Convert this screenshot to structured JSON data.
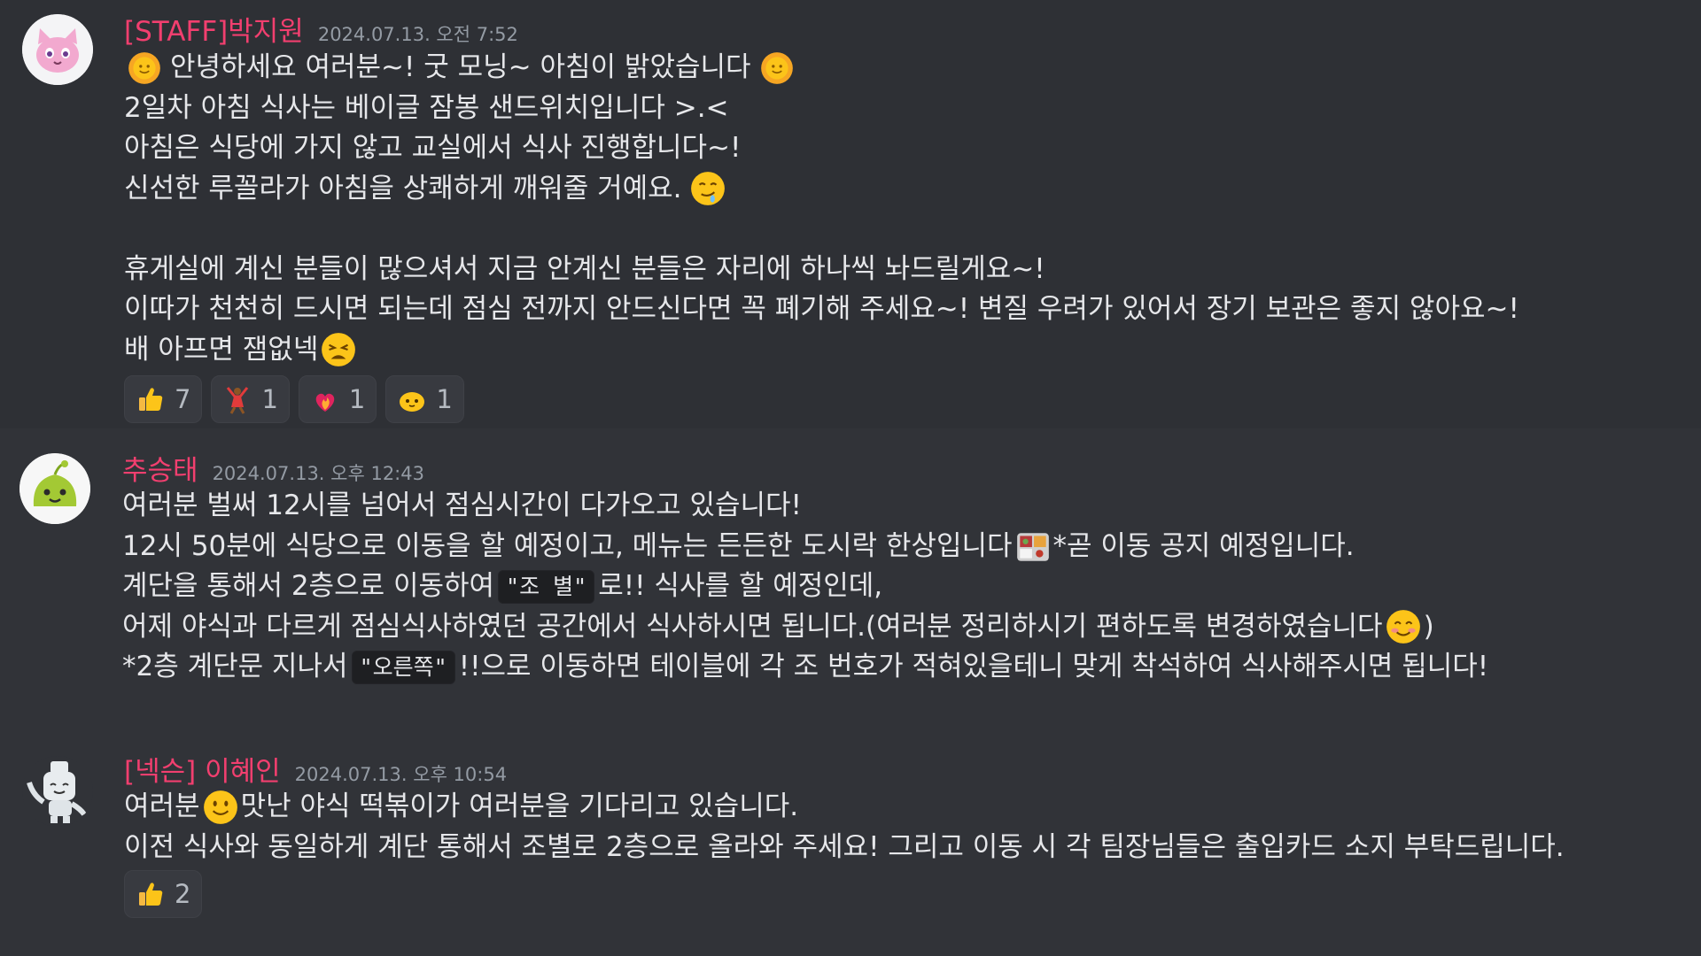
{
  "messages": [
    {
      "author": "[STAFF]박지원",
      "timestamp": "2024.07.13. 오전 7:52",
      "avatar": "pink-cat-avatar",
      "lines": [
        {
          "text": "안녕하세요 여러분~! 굿 모닝~ 아침이 밝았습니다"
        },
        {
          "text": "2일차 아침 식사는 베이글 잠봉 샌드위치입니다 >.<"
        },
        {
          "text": "아침은 식당에 가지 않고 교실에서 식사 진행합니다~!"
        },
        {
          "text": "신선한 루꼴라가 아침을 상쾌하게 깨워줄 거예요."
        },
        {
          "text": ""
        },
        {
          "text": "휴게실에 계신 분들이 많으셔서 지금 안계신 분들은 자리에 하나씩 놔드릴게요~!"
        },
        {
          "text": "이따가 천천히 드시면 되는데 점심 전까지 안드신다면 꼭 폐기해 주세요~! 변질 우려가 있어서 장기 보관은 좋지 않아요~!"
        },
        {
          "text": "배 아프면 잼없넥"
        }
      ],
      "reactions": [
        {
          "icon": "thumbs-up",
          "count": "7"
        },
        {
          "icon": "dancer",
          "count": "1"
        },
        {
          "icon": "fire",
          "count": "1"
        },
        {
          "icon": "blob",
          "count": "1"
        }
      ]
    },
    {
      "author": "추승태",
      "timestamp": "2024.07.13. 오후 12:43",
      "avatar": "green-slime-avatar",
      "lines": [
        {
          "text": "여러분 벌써 12시를 넘어서 점심시간이 다가오고 있습니다!"
        },
        {
          "text": "12시 50분에 식당으로 이동을 할 예정이고, 메뉴는 든든한 도시락 한상입니다",
          "after": " *곧 이동 공지 예정입니다."
        },
        {
          "before": "계단을 통해서 2층으로 이동하여 ",
          "code": "\"조  별\"",
          "after": "로!! 식사를 할 예정인데,"
        },
        {
          "text": "어제 야식과 다르게 점심식사하였던 공간에서 식사하시면 됩니다.(여러분 정리하시기 편하도록 변경하였습니다",
          "after": ")"
        },
        {
          "before": "*2층 계단문 지나서 ",
          "code": "\"오른쪽\"",
          "after": "!!으로 이동하면 테이블에 각 조 번호가 적혀있을테니 맞게 착석하여 식사해주시면 됩니다!"
        }
      ]
    },
    {
      "author": "[넥슨] 이혜인",
      "timestamp": "2024.07.13. 오후 10:54",
      "avatar": "robot-mascot-avatar",
      "lines": [
        {
          "before": "여러분 ",
          "after": " 맛난 야식 떡볶이가 여러분을 기다리고 있습니다."
        },
        {
          "text": "이전 식사와 동일하게 계단 통해서 조별로 2층으로 올라와 주세요! 그리고 이동 시 각 팀장님들은 출입카드 소지 부탁드립니다."
        }
      ],
      "reactions": [
        {
          "icon": "thumbs-up",
          "count": "2"
        }
      ]
    }
  ],
  "colors": {
    "author": "#f23f6f",
    "timestamp": "#949ba4",
    "background": "#313338"
  }
}
